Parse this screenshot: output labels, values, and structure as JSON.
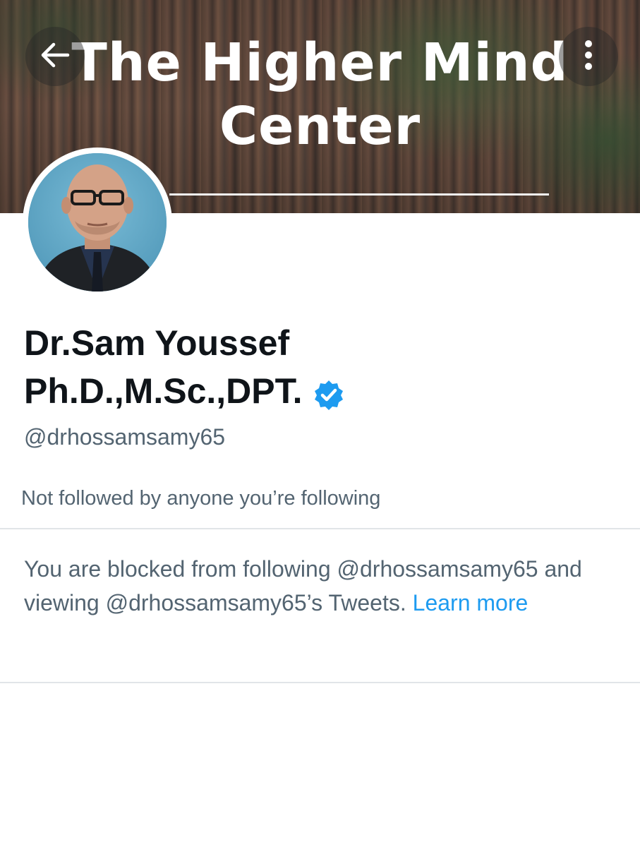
{
  "header": {
    "banner_title": "The Higher Mind Center",
    "back_icon": "arrow-left-icon",
    "more_icon": "more-vertical-icon"
  },
  "profile": {
    "name_line_1": "Dr.Sam Youssef",
    "name_line_2": "Ph.D.,M.Sc.,DPT.",
    "verified_icon": "verified-badge-icon",
    "handle": "@drhossamsamy65",
    "followers_note": "Not followed by anyone you’re following"
  },
  "blocked": {
    "message": "You are blocked from following @drhossamsamy65 and viewing @drhossamsamy65’s Tweets.",
    "link_label": "Learn more"
  },
  "colors": {
    "text_primary": "#0f1419",
    "text_secondary": "#536471",
    "link": "#1d9bf0",
    "divider": "#e1e5e8"
  }
}
